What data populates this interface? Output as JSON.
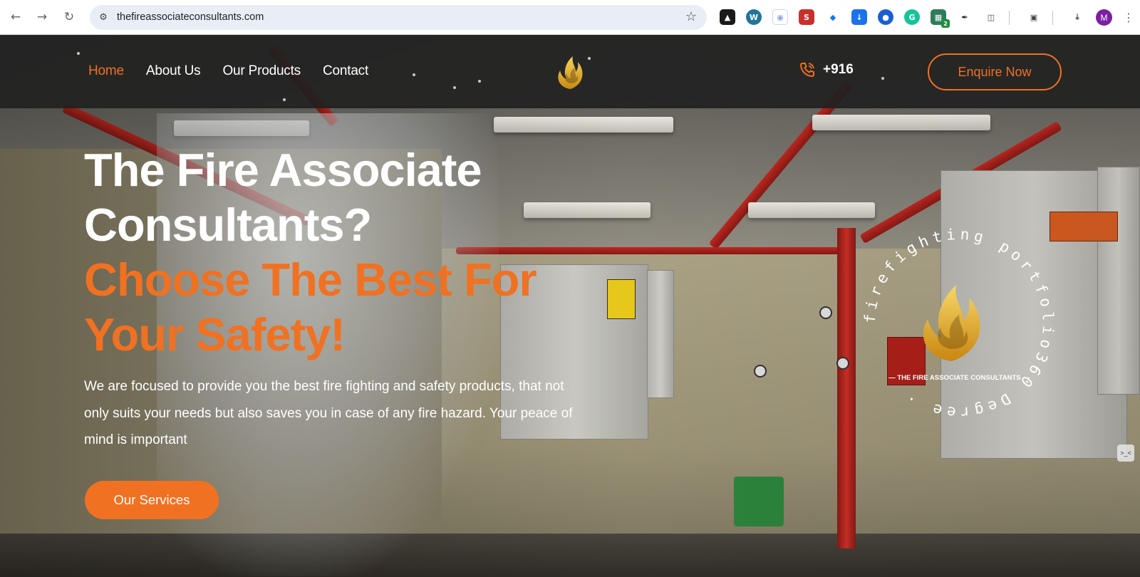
{
  "browser": {
    "url": "thefireassociateconsultants.com",
    "profile_initial": "M",
    "extension_badge": "2"
  },
  "header": {
    "menu": [
      "Home",
      "About Us",
      "Our Products",
      "Contact"
    ],
    "phone": "+916",
    "enquire_label": "Enquire Now"
  },
  "hero": {
    "title_line1": "The Fire Associate",
    "title_line2": "Consultants?",
    "highlight_line1": "Choose The Best For",
    "highlight_line2": "Your Safety!",
    "description": "We are focused to provide you the best fire fighting and safety products, that not only suits your needs but also saves you in case of any fire hazard. Your peace of mind is important",
    "cta_label": "Our Services"
  },
  "badge": {
    "circular_text": "firefighting portfolio360 Degree ·",
    "brand": "— THE FIRE ASSOCIATE CONSULTANTS —"
  },
  "colors": {
    "accent": "#f07121",
    "header_bg": "#202020",
    "gold": "#e3a91f"
  },
  "icons": {
    "back": "back-arrow-icon",
    "forward": "forward-arrow-icon",
    "reload": "reload-icon",
    "bookmark": "star-icon",
    "phone": "phone-icon",
    "logo": "flame-logo-icon"
  }
}
